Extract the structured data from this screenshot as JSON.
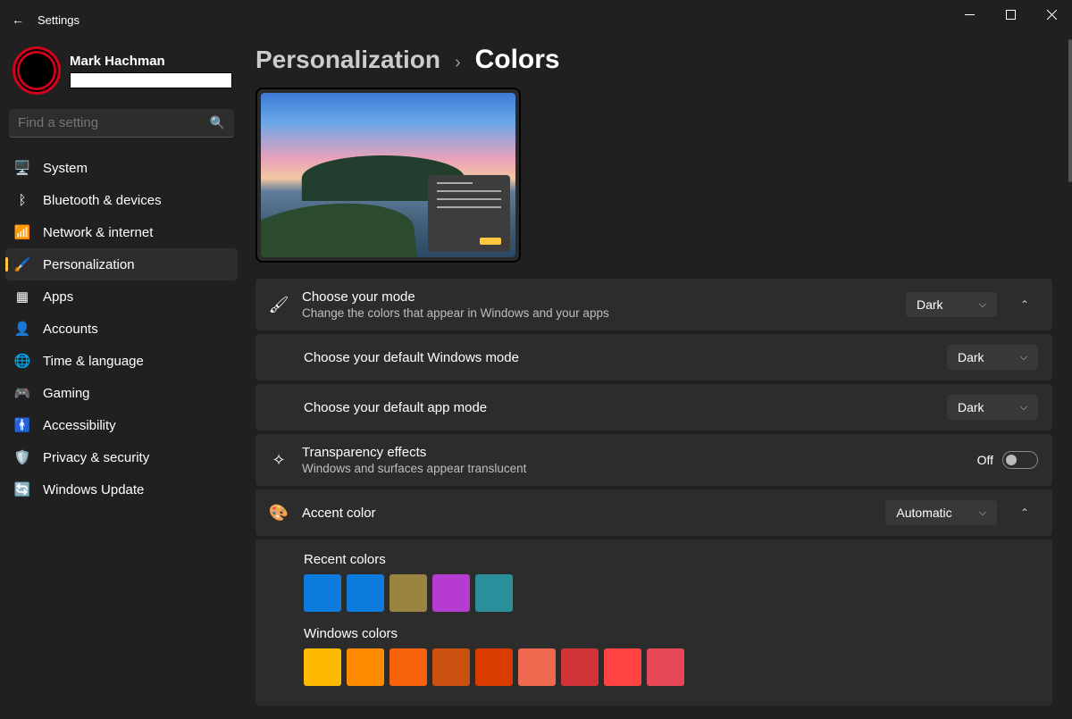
{
  "window": {
    "title": "Settings"
  },
  "profile": {
    "name": "Mark Hachman"
  },
  "search": {
    "placeholder": "Find a setting"
  },
  "nav": {
    "items": [
      {
        "label": "System",
        "icon": "🖥️"
      },
      {
        "label": "Bluetooth & devices",
        "icon": "ᛒ"
      },
      {
        "label": "Network & internet",
        "icon": "📶"
      },
      {
        "label": "Personalization",
        "icon": "🖌️",
        "active": true
      },
      {
        "label": "Apps",
        "icon": "▦"
      },
      {
        "label": "Accounts",
        "icon": "👤"
      },
      {
        "label": "Time & language",
        "icon": "🌐"
      },
      {
        "label": "Gaming",
        "icon": "🎮"
      },
      {
        "label": "Accessibility",
        "icon": "🚹"
      },
      {
        "label": "Privacy & security",
        "icon": "🛡️"
      },
      {
        "label": "Windows Update",
        "icon": "🔄"
      }
    ]
  },
  "breadcrumb": {
    "parent": "Personalization",
    "sep": "›",
    "current": "Colors"
  },
  "mode": {
    "title": "Choose your mode",
    "sub": "Change the colors that appear in Windows and your apps",
    "value": "Dark",
    "windows": {
      "title": "Choose your default Windows mode",
      "value": "Dark"
    },
    "app": {
      "title": "Choose your default app mode",
      "value": "Dark"
    }
  },
  "transparency": {
    "title": "Transparency effects",
    "sub": "Windows and surfaces appear translucent",
    "state_label": "Off"
  },
  "accent": {
    "title": "Accent color",
    "value": "Automatic",
    "recent_label": "Recent colors",
    "recent_colors": [
      "#0d7bdc",
      "#0d7bdc",
      "#9a8441",
      "#b53bd1",
      "#2b8f9c"
    ],
    "windows_label": "Windows colors",
    "windows_colors": [
      "#ffb900",
      "#ff8c00",
      "#f7630c",
      "#ca5010",
      "#da3b01",
      "#ef6950",
      "#d13438",
      "#ff4343",
      "#e74856"
    ]
  }
}
